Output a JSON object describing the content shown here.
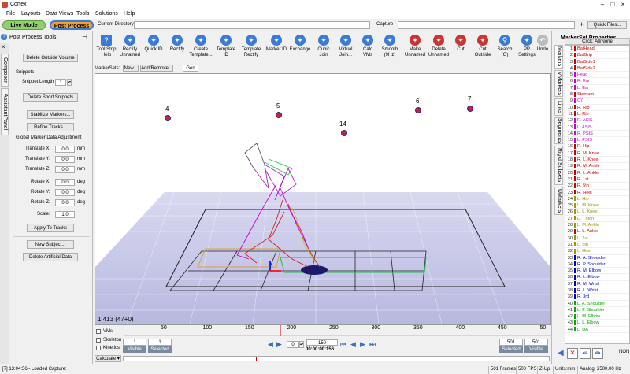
{
  "app": {
    "title": "Cortex"
  },
  "menu": [
    "File",
    "Layouts",
    "Data Views",
    "Tools",
    "Solutions",
    "Help"
  ],
  "modes": {
    "live": "Live Mode",
    "post": "Post Process"
  },
  "dir": {
    "label": "Current Directory",
    "value": ""
  },
  "capture": {
    "label": "Capture",
    "value": ""
  },
  "quick_files": "Quick Files...",
  "left_panel": {
    "title": "Post Process Tools",
    "tabs": [
      "Composer",
      "AssistantPanel"
    ],
    "delete_outside_volume": "Delete Outside Volume",
    "snippets_label": "Snippets",
    "snippet_length_label": "Snippet Length",
    "snippet_length_value": "1",
    "delete_short_snippets": "Delete Short Snippets",
    "stabilize_markers": "Stabilize Markers...",
    "refine_tracks": "Refine Tracks...",
    "global_adj_label": "Global Marker Data Adjustment",
    "translate_x_label": "Translate X:",
    "translate_x": "0.0",
    "translate_y_label": "Translate Y:",
    "translate_y": "0.0",
    "translate_z_label": "Translate Z:",
    "translate_z": "0.0",
    "rotate_x_label": "Rotate X:",
    "rotate_x": "0.0",
    "rotate_y_label": "Rotate Y:",
    "rotate_y": "0.0",
    "rotate_z_label": "Rotate Z:",
    "rotate_z": "0.0",
    "unit_mm": "mm",
    "unit_deg": "deg",
    "scale_label": "Scale:",
    "scale": "1.0",
    "apply_to_tracks": "Apply To Tracks",
    "new_subject": "New Subject...",
    "delete_artificial": "Delete Artificial Data"
  },
  "toolbar": [
    {
      "label": "Tool Strip\nHelp",
      "icon": "help-icon"
    },
    {
      "label": "Rectify\nUnnamed",
      "icon": "rectify-unnamed-icon"
    },
    {
      "label": "Quick ID",
      "icon": "quick-id-icon"
    },
    {
      "label": "Rectify",
      "icon": "rectify-icon"
    },
    {
      "label": "Create\nTemplate...",
      "icon": "create-template-icon"
    },
    {
      "label": "Template\nID",
      "icon": "template-id-icon"
    },
    {
      "label": "Template\nRectify",
      "icon": "template-rectify-icon"
    },
    {
      "label": "Marker ID",
      "icon": "marker-id-icon"
    },
    {
      "label": "Exchange",
      "icon": "exchange-icon"
    },
    {
      "label": "Cubic\nJoin",
      "icon": "cubic-join-icon"
    },
    {
      "label": "Virtual\nJoin...",
      "icon": "virtual-join-icon"
    },
    {
      "label": "Calc\nVMs",
      "icon": "calc-vms-icon"
    },
    {
      "label": "Smooth\n(9Hz)",
      "icon": "smooth-icon"
    },
    {
      "label": "Make\nUnnamed",
      "icon": "make-unnamed-icon"
    },
    {
      "label": "Delete\nUnnamed",
      "icon": "delete-unnamed-icon"
    },
    {
      "label": "Cut",
      "icon": "cut-icon"
    },
    {
      "label": "Cut\nOutside",
      "icon": "cut-outside-icon"
    },
    {
      "label": "Search\n(G)",
      "icon": "search-icon"
    },
    {
      "label": "PP\nSettings",
      "icon": "settings-icon"
    },
    {
      "label": "Undo",
      "icon": "undo-icon"
    }
  ],
  "markersets": {
    "label": "MarkerSets:",
    "new": "New...",
    "add_remove": "Add/Remove...",
    "name": "Gen"
  },
  "viewport": {
    "marker_labels": [
      "4",
      "5",
      "6",
      "7",
      "14"
    ],
    "readout": "1.413 (47+0)"
  },
  "timeline": {
    "ticks": [
      "50",
      "100",
      "150",
      "200",
      "250",
      "300",
      "350",
      "400",
      "450",
      "50"
    ],
    "vms": "VMs",
    "skeleton": "Skeleton",
    "kinetics": "Kinetics",
    "start_frame": "1",
    "start_frame2": "1",
    "visible": "Visible",
    "selected": "Selected",
    "step_value": "0",
    "current_frame": "150",
    "current_time": "00:00:00:156",
    "end_frame": "501",
    "end_frame2": "501",
    "calculate": "Calculate"
  },
  "right_panel": {
    "title": "MarkerSet Properties",
    "tabs": [
      "Markers",
      "VMarkers",
      "Links",
      "Segments",
      "Rigid Subsets",
      "UMarkers"
    ],
    "click_all_none": "Click: All/None",
    "markers": [
      {
        "n": "1",
        "name": "BatHead",
        "color": "#cc0000"
      },
      {
        "n": "2",
        "name": "BatGrip",
        "color": "#cc0000"
      },
      {
        "n": "3",
        "name": "BatSide1",
        "color": "#cc0000"
      },
      {
        "n": "4",
        "name": "BatSide2",
        "color": "#cc0000"
      },
      {
        "n": "5",
        "name": "Head",
        "color": "#cc00cc"
      },
      {
        "n": "6",
        "name": "R. Ear",
        "color": "#cc00cc"
      },
      {
        "n": "7",
        "name": "L. Ear",
        "color": "#cc00cc"
      },
      {
        "n": "8",
        "name": "Sternum",
        "color": "#cc0000"
      },
      {
        "n": "9",
        "name": "C7",
        "color": "#cc00cc"
      },
      {
        "n": "10",
        "name": "R. Rib",
        "color": "#cc0000"
      },
      {
        "n": "11",
        "name": "L. Rib",
        "color": "#cc0000"
      },
      {
        "n": "12",
        "name": "R. ASIS",
        "color": "#cc00cc"
      },
      {
        "n": "13",
        "name": "L. ASIS",
        "color": "#cc00cc"
      },
      {
        "n": "14",
        "name": "R. PSIS",
        "color": "#cc00cc"
      },
      {
        "n": "15",
        "name": "L. PSIS",
        "color": "#cc00cc"
      },
      {
        "n": "16",
        "name": "R. Hip",
        "color": "#cc0000"
      },
      {
        "n": "17",
        "name": "R. M. Knee",
        "color": "#cc0000"
      },
      {
        "n": "18",
        "name": "R. L. Knee",
        "color": "#cc0000"
      },
      {
        "n": "19",
        "name": "R. M. Ankle",
        "color": "#cc0000"
      },
      {
        "n": "20",
        "name": "R. L. Ankle",
        "color": "#cc0000"
      },
      {
        "n": "21",
        "name": "R. 1st",
        "color": "#cc0000"
      },
      {
        "n": "22",
        "name": "R. 5th",
        "color": "#cc0000"
      },
      {
        "n": "23",
        "name": "R. Heel",
        "color": "#cc0000"
      },
      {
        "n": "24",
        "name": "L. Hip",
        "color": "#9a9a00"
      },
      {
        "n": "25",
        "name": "L. M. Knee",
        "color": "#9a9a00"
      },
      {
        "n": "26",
        "name": "L. L. Knee",
        "color": "#9a9a00"
      },
      {
        "n": "27",
        "name": "D. Thigh",
        "color": "#9a9a00"
      },
      {
        "n": "28",
        "name": "L. M. Ankle",
        "color": "#9a9a00"
      },
      {
        "n": "29",
        "name": "L. L. Ankle",
        "color": "#cc0000"
      },
      {
        "n": "30",
        "name": "L. 1st",
        "color": "#9a9a00"
      },
      {
        "n": "31",
        "name": "L. 5th",
        "color": "#9a9a00"
      },
      {
        "n": "32",
        "name": "L. Heel",
        "color": "#9a9a00"
      },
      {
        "n": "33",
        "name": "R. A. Shoulder",
        "color": "#0000cc"
      },
      {
        "n": "34",
        "name": "R. P. Shoulder",
        "color": "#0000cc"
      },
      {
        "n": "35",
        "name": "R. M. Elbow",
        "color": "#0000cc"
      },
      {
        "n": "36",
        "name": "R. L. Elbow",
        "color": "#0000cc"
      },
      {
        "n": "37",
        "name": "R. M. Wrist",
        "color": "#0000cc"
      },
      {
        "n": "38",
        "name": "R. L. Wrist",
        "color": "#0000cc"
      },
      {
        "n": "39",
        "name": "R. 3rd",
        "color": "#0000cc"
      },
      {
        "n": "40",
        "name": "L. A. Shoulder",
        "color": "#00aa00"
      },
      {
        "n": "41",
        "name": "L. P. Shoulder",
        "color": "#00aa00"
      },
      {
        "n": "42",
        "name": "L. M. Elbow",
        "color": "#00aa00"
      },
      {
        "n": "43",
        "name": "L. L. Elbow",
        "color": "#00aa00"
      },
      {
        "n": "44",
        "name": "L. UA",
        "color": "#00aa00"
      }
    ]
  },
  "status": {
    "left": "[7] 13:04:56 - Loaded Capture:",
    "frames": "501 Frames",
    "fps": "500 FPS",
    "zup": "Z-Up",
    "units": "Units:mm",
    "analog": "Analog: 2500.00 Hz"
  },
  "colors": {
    "live_mode": "#90d070",
    "post_process": "#f0a030",
    "viewport_floor": "#c8c8e8",
    "accent": "#3a7bd5"
  }
}
